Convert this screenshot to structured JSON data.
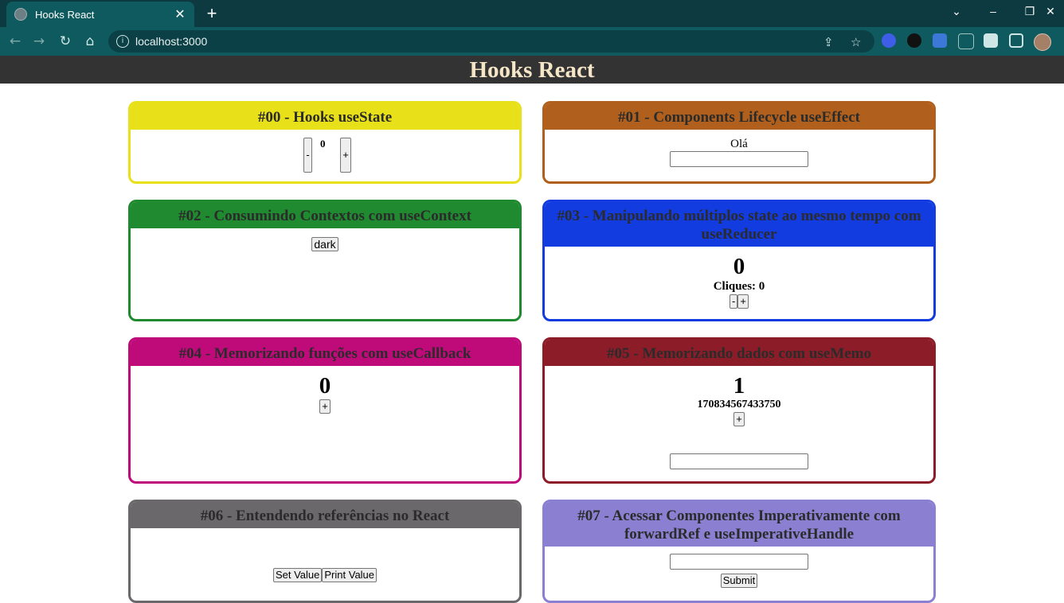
{
  "browser": {
    "tab_title": "Hooks React",
    "tab_close": "✕",
    "new_tab": "+",
    "url": "localhost:3000",
    "window_controls": [
      "⌄",
      "–",
      "❐",
      "✕"
    ]
  },
  "page": {
    "title": "Hooks React"
  },
  "cards": [
    {
      "title": "#00 - Hooks useState",
      "color": "#e8e018",
      "minus": "-",
      "value": "0",
      "plus": "+"
    },
    {
      "title": "#01 - Components Lifecycle useEffect",
      "color": "#b0601c",
      "greeting": "Olá"
    },
    {
      "title": "#02 - Consumindo Contextos com useContext",
      "color": "#1f8a2f",
      "button": "dark"
    },
    {
      "title": "#03 - Manipulando múltiplos state ao mesmo tempo com useReducer",
      "color": "#123be0",
      "value": "0",
      "clicks": "Cliques: 0",
      "minus": "-",
      "plus": "+"
    },
    {
      "title": "#04 - Memorizando funções com useCallback",
      "color": "#bf0a7a",
      "value": "0",
      "plus": "+"
    },
    {
      "title": "#05 - Memorizando dados com useMemo",
      "color": "#8c1c28",
      "value": "1",
      "memo": "170834567433750",
      "plus": "+"
    },
    {
      "title": "#06 - Entendendo referências no React",
      "color": "#6a686b",
      "btn1": "Set Value",
      "btn2": "Print Value"
    },
    {
      "title": "#07 - Acessar Componentes Imperativamente com forwardRef e useImperativeHandle",
      "color": "#8b7fd2",
      "submit": "Submit"
    }
  ]
}
